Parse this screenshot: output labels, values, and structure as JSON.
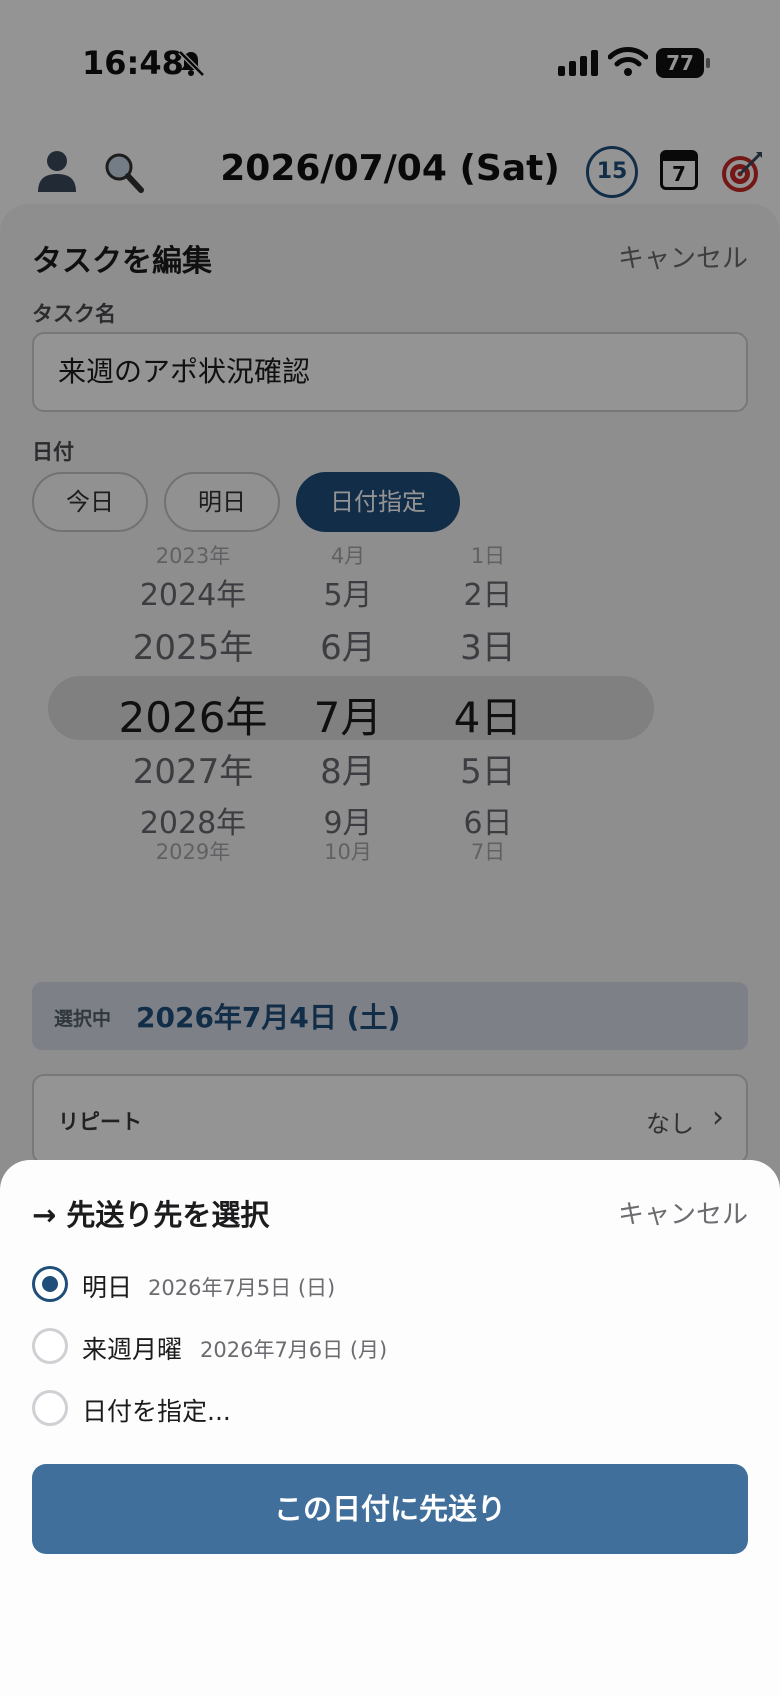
{
  "status_bar": {
    "time": "16:48",
    "battery": "77"
  },
  "nav": {
    "title": "2026/07/04 (Sat)",
    "badge_count": "15",
    "calendar_day": "7"
  },
  "edit_sheet": {
    "title": "タスクを編集",
    "cancel": "キャンセル",
    "task_name_label": "タスク名",
    "task_name_value": "来週のアポ状況確認",
    "date_label": "日付",
    "chips": [
      {
        "label": "今日"
      },
      {
        "label": "明日"
      },
      {
        "label": "日付指定"
      }
    ],
    "picker": {
      "years": [
        "2023年",
        "2024年",
        "2025年",
        "2026年",
        "2027年",
        "2028年",
        "2029年"
      ],
      "months": [
        "4月",
        "5月",
        "6月",
        "7月",
        "8月",
        "9月",
        "10月"
      ],
      "days": [
        "1日",
        "2日",
        "3日",
        "4日",
        "5日",
        "6日",
        "7日"
      ]
    },
    "selected_label": "選択中",
    "selected_value": "2026年7月4日 (土)",
    "repeat_label": "リピート",
    "repeat_value": "なし",
    "repeat_chevron": "›"
  },
  "postpone_sheet": {
    "title": "→ 先送り先を選択",
    "cancel": "キャンセル",
    "options": [
      {
        "label": "明日",
        "date": "2026年7月5日 (日)"
      },
      {
        "label": "来週月曜",
        "date": "2026年7月6日 (月)"
      },
      {
        "label": "日付を指定..."
      }
    ],
    "selected_index": 0,
    "confirm": "この日付に先送り"
  },
  "colors": {
    "accent": "#1f4e7a",
    "button": "#3f6f9a",
    "overlay": "rgba(0,0,0,0.42)"
  },
  "icons": [
    "bell-slash-icon",
    "signal-icon",
    "wifi-icon",
    "battery-icon",
    "user-icon",
    "search-icon",
    "calendar-icon",
    "target-icon",
    "chevron-right-icon"
  ]
}
